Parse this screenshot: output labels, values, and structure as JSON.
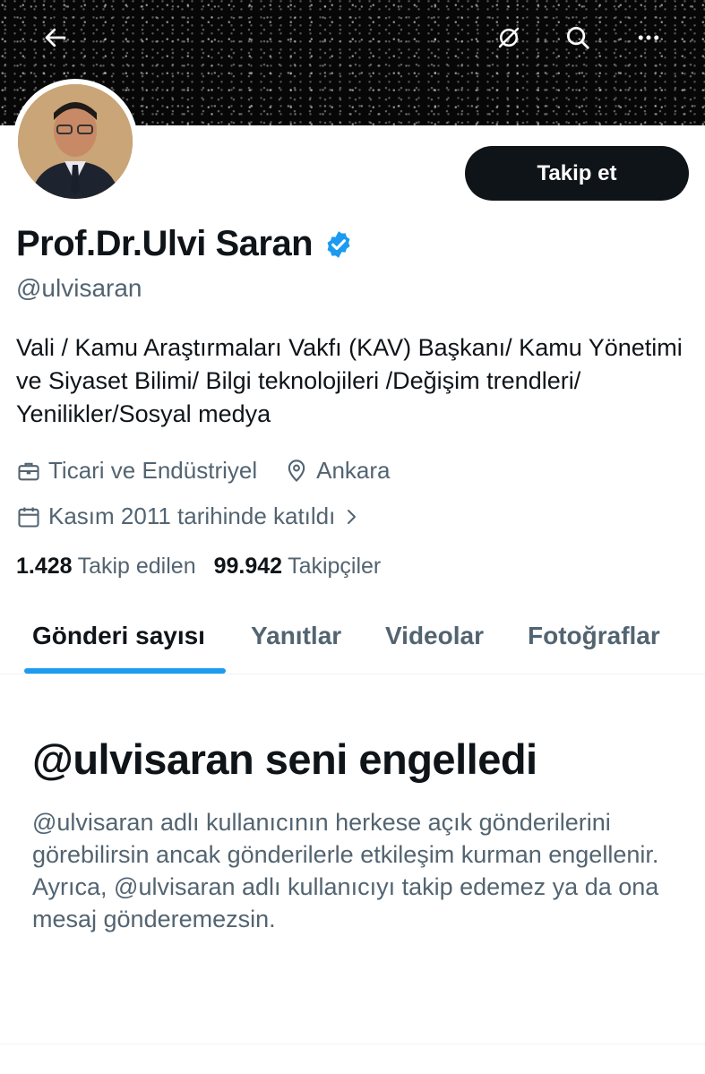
{
  "header": {
    "back_icon": "arrow-left-icon",
    "hide_icon": "eye-slash-icon",
    "search_icon": "search-icon",
    "more_icon": "more-horizontal-icon"
  },
  "profile": {
    "name": "Prof.Dr.Ulvi Saran",
    "handle": "@ulvisaran",
    "verified_color": "#1d9bf0",
    "follow_label": "Takip et",
    "bio": "Vali / Kamu Araştırmaları Vakfı (KAV) Başkanı/ Kamu Yönetimi ve Siyaset Bilimi/ Bilgi teknolojileri /Değişim trendleri/ Yenilikler/Sosyal medya",
    "category": "Ticari ve Endüstriyel",
    "location": "Ankara",
    "joined": "Kasım 2011 tarihinde katıldı",
    "following_count": "1.428",
    "following_label": "Takip edilen",
    "followers_count": "99.942",
    "followers_label": "Takipçiler"
  },
  "tabs": [
    {
      "label": "Gönderi sayısı",
      "active": true
    },
    {
      "label": "Yanıtlar",
      "active": false
    },
    {
      "label": "Videolar",
      "active": false
    },
    {
      "label": "Fotoğraflar",
      "active": false
    }
  ],
  "blocked": {
    "title": "@ulvisaran seni engelledi",
    "message": "@ulvisaran adlı kullanıcının herkese açık gönderilerini görebilirsin ancak gönderilerle etkileşim kurman engellenir. Ayrıca, @ulvisaran adlı kullanıcıyı takip edemez ya da ona mesaj gönderemezsin."
  }
}
